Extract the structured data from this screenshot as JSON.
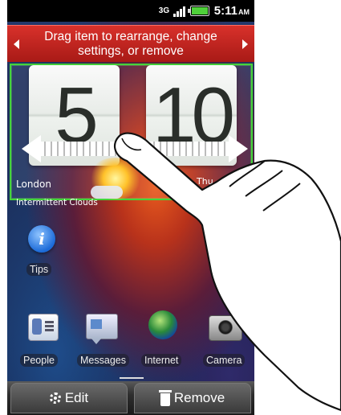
{
  "status_bar": {
    "network": "3G",
    "time": "5:11",
    "ampm": "AM"
  },
  "hint": {
    "text": "Drag item to rearrange, change settings, or remove"
  },
  "clock_widget": {
    "hours": "5",
    "minutes": "10",
    "city": "London",
    "weather": "Intermittent Clouds",
    "date": "Thu, A"
  },
  "shortcuts": {
    "tips": "Tips"
  },
  "dock": {
    "apps": [
      {
        "label": "People",
        "icon": "people-icon"
      },
      {
        "label": "Messages",
        "icon": "messages-icon"
      },
      {
        "label": "Internet",
        "icon": "globe-icon"
      },
      {
        "label": "Camera",
        "icon": "camera-icon"
      }
    ]
  },
  "bottom_bar": {
    "edit_label": "Edit",
    "remove_label": "Remove"
  },
  "colors": {
    "hint_bar": "#c8231e",
    "selection_border": "#44d43a"
  }
}
